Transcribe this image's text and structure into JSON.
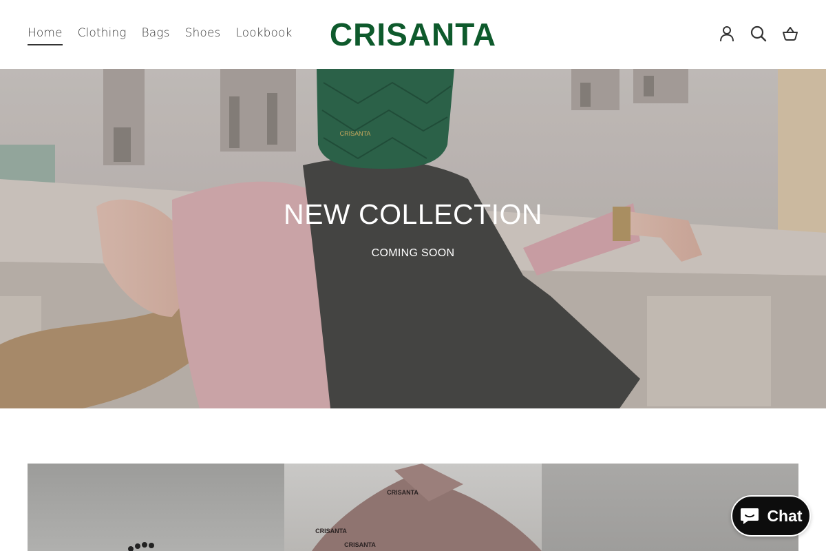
{
  "nav": {
    "items": [
      {
        "label": "Home",
        "active": true
      },
      {
        "label": "Clothing",
        "active": false
      },
      {
        "label": "Bags",
        "active": false
      },
      {
        "label": "Shoes",
        "active": false
      },
      {
        "label": "Lookbook",
        "active": false
      }
    ]
  },
  "brand": {
    "logo_text": "CRISANTA",
    "bag_stamp": "CRISANTA",
    "color": "#0e5a2c"
  },
  "header_icons": [
    "account-icon",
    "search-icon",
    "cart-icon"
  ],
  "hero": {
    "title": "NEW COLLECTION",
    "subtitle": "COMING SOON"
  },
  "products": {
    "tile_labels": [
      "CRISANTA",
      "CRISANTA",
      "CRISANTA"
    ]
  },
  "chat": {
    "label": "Chat",
    "icon": "chat-bubble-icon"
  }
}
